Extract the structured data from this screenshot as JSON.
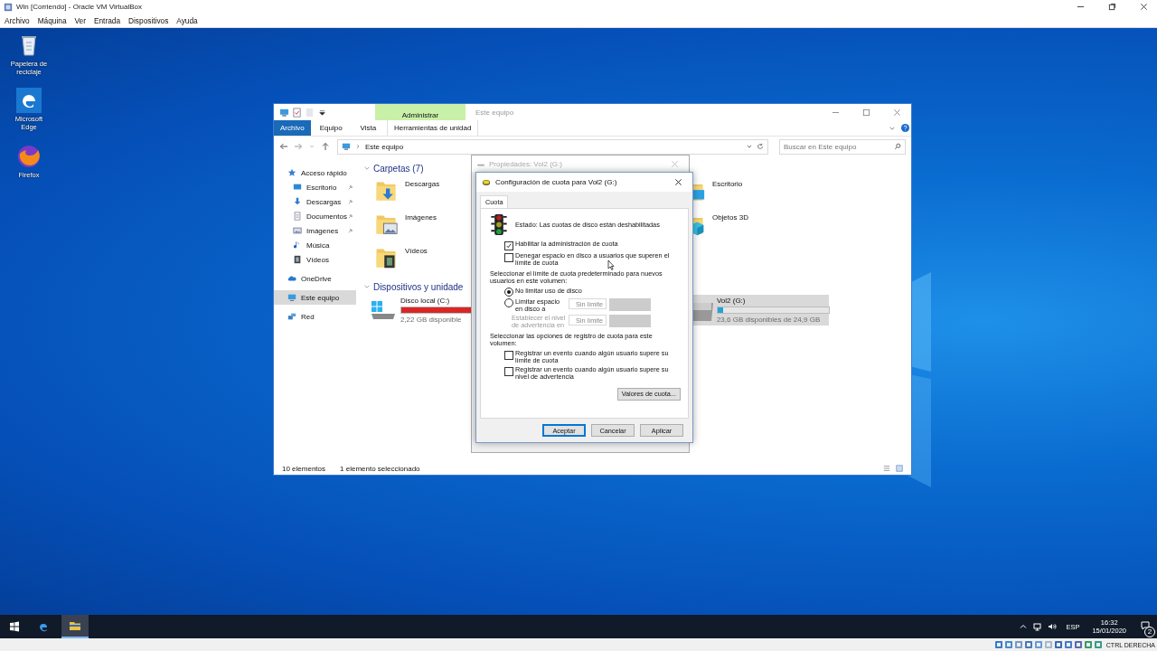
{
  "vm_window": {
    "title": "Win [Corriendo] - Oracle VM VirtualBox",
    "menu": [
      "Archivo",
      "Máquina",
      "Ver",
      "Entrada",
      "Dispositivos",
      "Ayuda"
    ]
  },
  "desktop_icons": [
    {
      "label": "Papelera de reciclaje",
      "kind": "recycle"
    },
    {
      "label": "Microsoft Edge",
      "kind": "edge"
    },
    {
      "label": "Firefox",
      "kind": "firefox"
    }
  ],
  "explorer": {
    "title": "Este equipo",
    "file_tab": "Archivo",
    "tabs": [
      "Equipo",
      "Vista"
    ],
    "context_tab": {
      "group": "Administrar",
      "label": "Herramientas de unidad"
    },
    "address": "Este equipo",
    "search": {
      "placeholder": "Buscar en Este equipo"
    },
    "sidebar": [
      {
        "label": "Acceso rápido",
        "kind": "star",
        "selected": false,
        "children": [
          {
            "label": "Escritorio",
            "kind": "desktop",
            "pinned": true,
            "selected": false
          },
          {
            "label": "Descargas",
            "kind": "download",
            "pinned": true,
            "selected": false
          },
          {
            "label": "Documentos",
            "kind": "document",
            "pinned": true,
            "selected": false
          },
          {
            "label": "Imágenes",
            "kind": "image",
            "pinned": true,
            "selected": false
          },
          {
            "label": "Música",
            "kind": "music",
            "pinned": false,
            "selected": false
          },
          {
            "label": "Vídeos",
            "kind": "video",
            "pinned": false,
            "selected": false
          }
        ]
      },
      {
        "label": "OneDrive",
        "kind": "cloud",
        "selected": false
      },
      {
        "label": "Este equipo",
        "kind": "computer",
        "selected": true
      },
      {
        "label": "Red",
        "kind": "network",
        "selected": false
      }
    ],
    "folders_heading": "Carpetas (7)",
    "folders": [
      {
        "label": "Descargas",
        "kind": "download"
      },
      {
        "label": "Imágenes",
        "kind": "image"
      },
      {
        "label": "Vídeos",
        "kind": "video"
      },
      {
        "label": "Escritorio",
        "kind": "desktop"
      },
      {
        "label": "Objetos 3D",
        "kind": "cube"
      }
    ],
    "drives_heading": "Dispositivos y unidade",
    "drives": [
      {
        "label": "Disco local (C:)",
        "kind": "system",
        "level": 0.92,
        "free": "2,22 GB disponible",
        "selected": false
      },
      {
        "label": "Vol2 (G:)",
        "kind": "plain",
        "level": 0.05,
        "free": "23,6 GB disponibles de 24,9 GB",
        "selected": true
      }
    ],
    "status": [
      "10 elementos",
      "1 elemento seleccionado"
    ]
  },
  "properties_dialog": {
    "title": "Propiedades: Vol2 (G:)"
  },
  "quota_dialog": {
    "title": "Configuración de cuota para Vol2 (G:)",
    "tab": "Cuota",
    "status": "Estado:  Las cuotas de disco están deshabilitadas",
    "enable": {
      "label": "Habilitar la administración de cuota",
      "checked": true
    },
    "deny": {
      "label": "Denegar espacio en disco a usuarios que superen el límite de cuota",
      "checked": false
    },
    "limit_prompt": "Seleccionar el límite de cuota predeterminado para nuevos usuarios en este volumen:",
    "no_limit": {
      "label": "No limitar uso de disco",
      "selected": true
    },
    "limit": {
      "label": "Limitar espacio en disco a",
      "selected": false,
      "value": "Sin límite"
    },
    "warning": {
      "label": "Establecer el nivel de advertencia en",
      "disabled": true,
      "value": "Sin límite"
    },
    "log_prompt": "Seleccionar las opciones de registro de cuota para este volumen:",
    "log_options": [
      {
        "label": "Registrar un evento cuando algún usuario supere su límite de cuota",
        "checked": false
      },
      {
        "label": "Registrar un evento cuando algún usuario supere su nivel de advertencia",
        "checked": false
      }
    ],
    "entries_button": "Valores de cuota...",
    "buttons": [
      {
        "label": "Aceptar",
        "default": true
      },
      {
        "label": "Cancelar",
        "default": false
      },
      {
        "label": "Aplicar",
        "default": false
      }
    ]
  },
  "taskbar": {
    "language": "ESP",
    "time": "16:32",
    "date": "15/01/2020",
    "notifications": "2"
  },
  "vm_status": {
    "host_key": "CTRL DERECHA"
  }
}
